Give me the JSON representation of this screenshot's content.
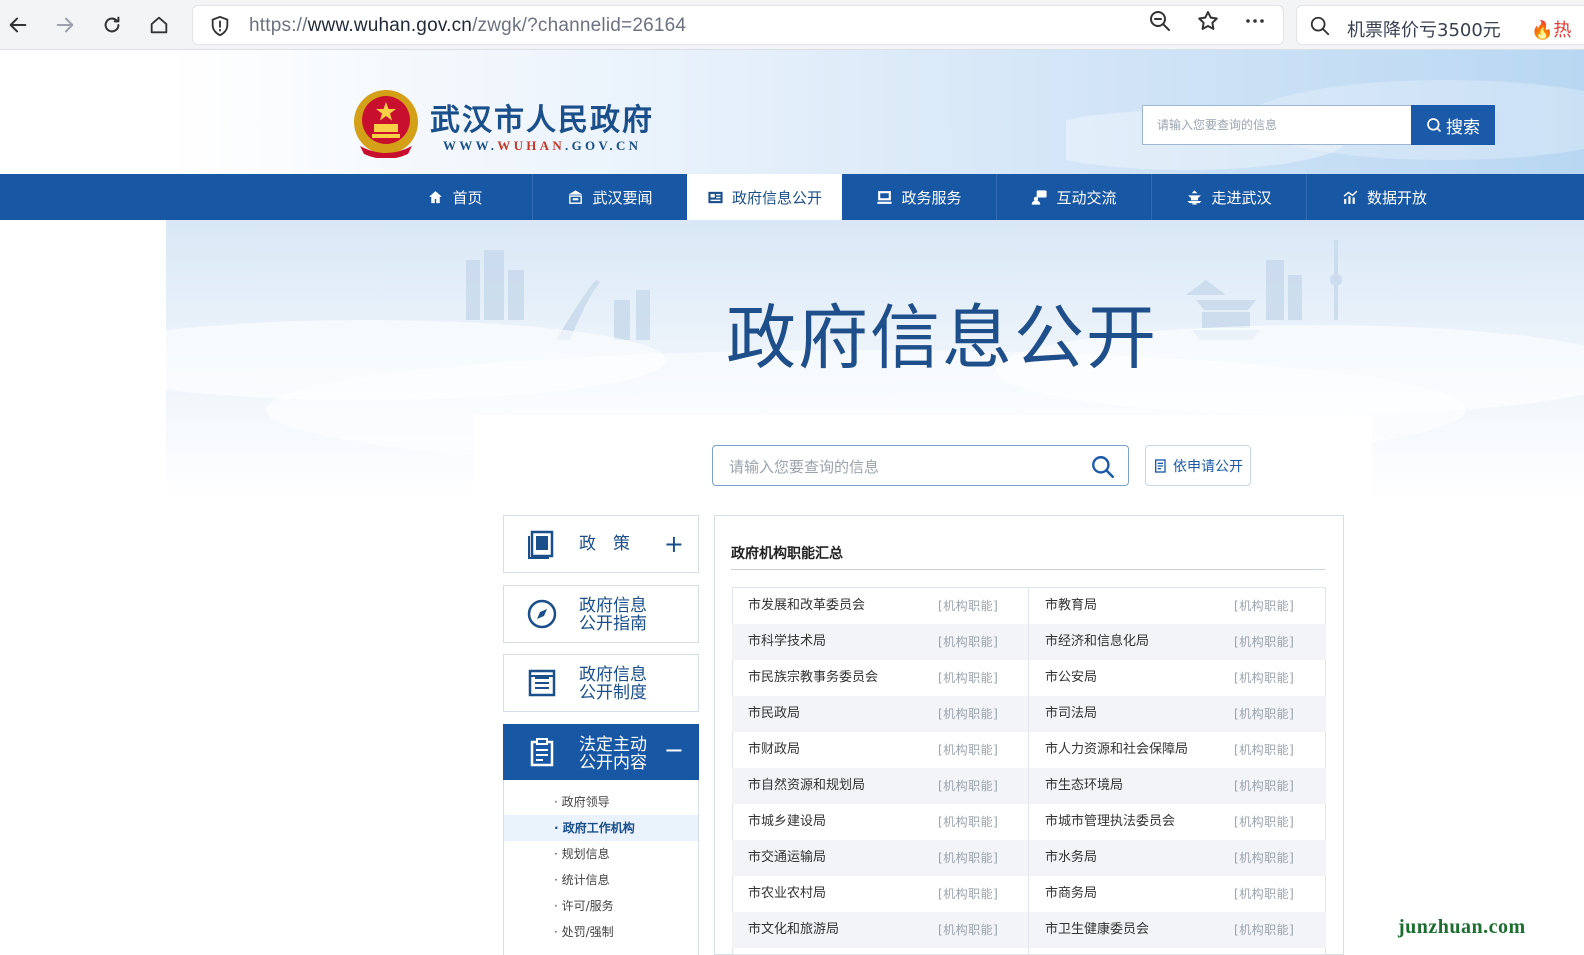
{
  "browser": {
    "url_prefix": "https://",
    "url_host": "www.wuhan.gov.cn",
    "url_path": "/zwgk/?channelid=26164",
    "search_text": "机票降价亏3500元",
    "hot_text": "热"
  },
  "site": {
    "title": "武汉市人民政府",
    "url_a": "WWW.",
    "url_b": "WUHAN",
    "url_c": ".GOV.CN",
    "search_placeholder": "请输入您要查询的信息",
    "search_button": "搜索"
  },
  "nav": [
    {
      "label": "首页",
      "icon": "home-icon"
    },
    {
      "label": "武汉要闻",
      "icon": "building-icon"
    },
    {
      "label": "政府信息公开",
      "icon": "newspaper-icon"
    },
    {
      "label": "政务服务",
      "icon": "monitor-icon"
    },
    {
      "label": "互动交流",
      "icon": "chat-icon"
    },
    {
      "label": "走进武汉",
      "icon": "pagoda-icon"
    },
    {
      "label": "数据开放",
      "icon": "chart-icon"
    }
  ],
  "banner": {
    "title": "政府信息公开"
  },
  "content": {
    "search_placeholder": "请输入您要查询的信息",
    "apply_label": "依申请公开"
  },
  "sidebar": {
    "policy": "政　策",
    "guide_1": "政府信息",
    "guide_2": "公开指南",
    "system_1": "政府信息",
    "system_2": "公开制度",
    "statutory_1": "法定主动",
    "statutory_2": "公开内容",
    "sub_items": [
      "· 政府领导",
      "· 政府工作机构",
      "· 规划信息",
      "· 统计信息",
      "· 许可/服务",
      "· 处罚/强制"
    ]
  },
  "table": {
    "title": "政府机构职能汇总",
    "tag": "[机构职能]",
    "rows": [
      [
        "市发展和改革委员会",
        "市教育局"
      ],
      [
        "市科学技术局",
        "市经济和信息化局"
      ],
      [
        "市民族宗教事务委员会",
        "市公安局"
      ],
      [
        "市民政局",
        "市司法局"
      ],
      [
        "市财政局",
        "市人力资源和社会保障局"
      ],
      [
        "市自然资源和规划局",
        "市生态环境局"
      ],
      [
        "市城乡建设局",
        "市城市管理执法委员会"
      ],
      [
        "市交通运输局",
        "市水务局"
      ],
      [
        "市农业农村局",
        "市商务局"
      ],
      [
        "市文化和旅游局",
        "市卫生健康委员会"
      ]
    ]
  },
  "watermark": "junzhuan.com"
}
